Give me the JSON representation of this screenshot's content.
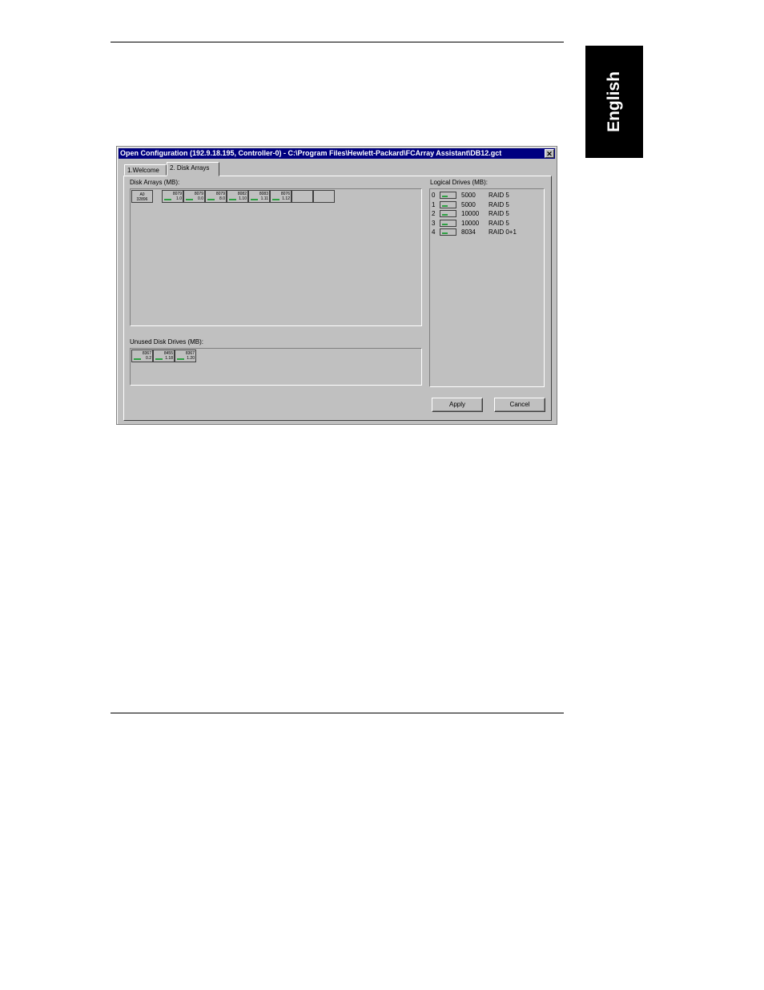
{
  "side_tab": {
    "label": "English"
  },
  "window": {
    "title": "Open Configuration (192.9.18.195, Controller-0) - C:\\Program Files\\Hewlett-Packard\\FCArray Assistant\\DB12.gct",
    "close_glyph": "✕"
  },
  "tabs": [
    {
      "label": "1.Welcome"
    },
    {
      "label": "2. Disk Arrays"
    }
  ],
  "disk_arrays": {
    "label": "Disk Arrays (MB):",
    "array_cell": {
      "id": "A0",
      "size": "32896"
    },
    "drives": [
      {
        "value": "8079",
        "slot": "1.0"
      },
      {
        "value": "8079",
        "slot": "0.0"
      },
      {
        "value": "8079",
        "slot": "8.0"
      },
      {
        "value": "8082",
        "slot": "1.10"
      },
      {
        "value": "8083",
        "slot": "1.11"
      },
      {
        "value": "8076",
        "slot": "1.12"
      }
    ]
  },
  "unused_drives": {
    "label": "Unused Disk Drives (MB):",
    "drives": [
      {
        "value": "8367",
        "slot": "0.2"
      },
      {
        "value": "8455",
        "slot": "1.18"
      },
      {
        "value": "8367",
        "slot": "1.20"
      }
    ]
  },
  "logical_drives": {
    "label": "Logical Drives (MB):",
    "rows": [
      {
        "index": "0",
        "size": "5000",
        "raid": "RAID 5"
      },
      {
        "index": "1",
        "size": "5000",
        "raid": "RAID 5"
      },
      {
        "index": "2",
        "size": "10000",
        "raid": "RAID 5"
      },
      {
        "index": "3",
        "size": "10000",
        "raid": "RAID 5"
      },
      {
        "index": "4",
        "size": "8034",
        "raid": "RAID 0+1"
      }
    ]
  },
  "buttons": {
    "apply": "Apply",
    "cancel": "Cancel"
  },
  "colors": {
    "titlebar": "#000080",
    "face": "#c0c0c0",
    "drive_indicator": "#2ea043"
  }
}
